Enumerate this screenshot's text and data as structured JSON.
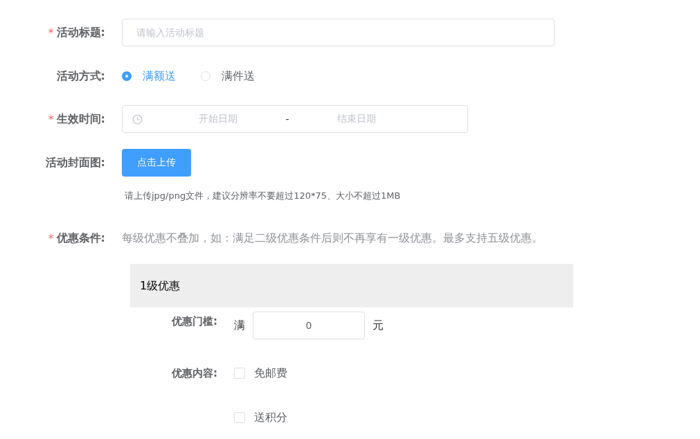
{
  "form": [
    {
      "kind": "text",
      "label": "活动标题:",
      "required_mark": "*",
      "placeholder": "请输入活动标题"
    },
    {
      "kind": "radio",
      "label": "活动方式:",
      "options": [
        {
          "label": "满额送",
          "selected": true
        },
        {
          "label": "满件送",
          "selected": false
        }
      ]
    },
    {
      "kind": "daterange",
      "label": "生效时间:",
      "required_mark": "*",
      "start_placeholder": "开始日期",
      "separator": "-",
      "end_placeholder": "结束日期"
    },
    {
      "kind": "upload",
      "label": "活动封面图:",
      "button": "点击上传",
      "hint": "请上传jpg/png文件，建议分辨率不要超过120*75、大小不超过1MB"
    },
    {
      "kind": "note",
      "label": "优惠条件:",
      "required_mark": "*",
      "text": "每级优惠不叠加，如：满足二级优惠条件后则不再享有一级优惠。最多支持五级优惠。"
    }
  ],
  "tier": {
    "title": "1级优惠",
    "threshold_label": "优惠门槛:",
    "prefix": "满",
    "value": "0",
    "suffix": "元",
    "content_label": "优惠内容:",
    "benefits": [
      {
        "label": "免邮费",
        "checked": false
      },
      {
        "label": "送积分",
        "checked": false
      }
    ]
  }
}
